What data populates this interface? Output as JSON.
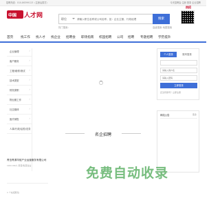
{
  "topbar": {
    "hotline": "招聘热线：010-86399123（注册后拨打）",
    "links": "今天招聘会  注册  登录  企业招聘"
  },
  "logo": {
    "mark": "中国",
    "name": "人才网"
  },
  "search": {
    "category": "职位",
    "placeholder": "请输入职位名称或公司名称，如：企业主管、行政经理",
    "button": "搜索",
    "hot": "热门搜索：",
    "helps": "高级搜索  地图搜索"
  },
  "mascot": {
    "tag": "热招"
  },
  "nav": [
    "首页",
    "找工作",
    "找人才",
    "找企业",
    "招聘会",
    "职场指南",
    "校园招聘",
    "公司",
    "招聘",
    "专题招聘",
    "学历提升"
  ],
  "sidebar": [
    "企业管理",
    "客户服务",
    "工程/维修/测试",
    "技术类型",
    "财务类职",
    "物业服工作",
    "社交媒体",
    "医疗销售",
    "人事/行政/后勤/法务"
  ],
  "login": {
    "tab_personal": "个人登录",
    "tab_company": "账号登录",
    "user_placeholder": "请输入用户名",
    "pass_placeholder": "请输入密码",
    "code_placeholder": "请输入验证码",
    "submit": "立即登录",
    "footer": "还没有账号？立即注册"
  },
  "notice": {
    "header": "网站公告",
    "more": "更多"
  },
  "section_title": "名企招聘",
  "company": {
    "name": "青岛青源华航产业运营服务有限公司",
    "meta": "100-199人  民营/私营企业",
    "jobs": "1 个在招职位"
  },
  "watermark": "免费自动收录"
}
